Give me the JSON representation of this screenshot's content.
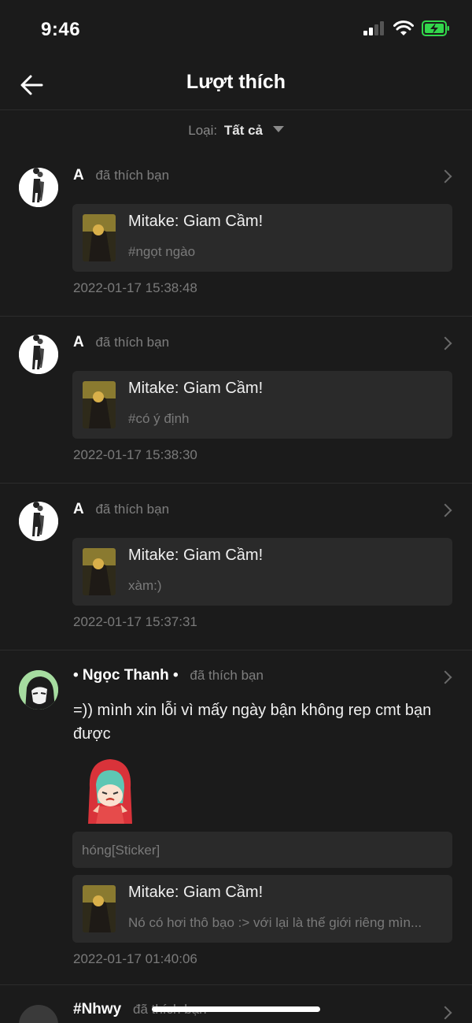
{
  "status": {
    "time": "9:46"
  },
  "nav": {
    "title": "Lượt thích"
  },
  "filter": {
    "label": "Loại:",
    "value": "Tất cả"
  },
  "items": [
    {
      "user": "",
      "user_icon": "A",
      "action": "đã thích bạn",
      "post_title": "Mitake: Giam Cầm!",
      "post_sub": "#ngọt ngào",
      "timestamp": "2022-01-17 15:38:48"
    },
    {
      "user": "",
      "user_icon": "A",
      "action": "đã thích bạn",
      "post_title": "Mitake: Giam Cầm!",
      "post_sub": "#có ý định",
      "timestamp": "2022-01-17 15:38:30"
    },
    {
      "user": "",
      "user_icon": "A",
      "action": "đã thích bạn",
      "post_title": "Mitake: Giam Cầm!",
      "post_sub": "xàm:)",
      "timestamp": "2022-01-17 15:37:31"
    },
    {
      "user": "• Ngọc Thanh •",
      "action": "đã thích bạn",
      "comment": "=)) mình xin lỗi vì mấy ngày bận không rep cmt bạn được",
      "reply": "hóng[Sticker]",
      "post_title": "Mitake: Giam Cầm!",
      "post_sub": "Nó có hơi thô bạo :> với lại là thế giới riêng mìn...",
      "timestamp": "2022-01-17 01:40:06"
    },
    {
      "user": "#Nhwy",
      "action": "đã thích bạn"
    }
  ]
}
